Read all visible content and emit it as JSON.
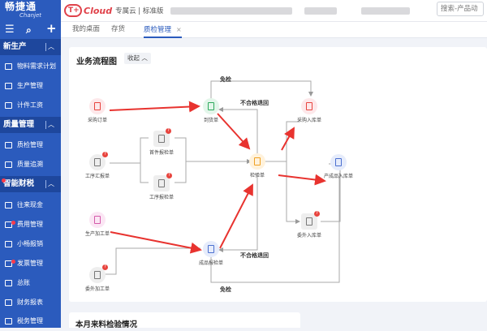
{
  "app": {
    "logo_cn": "畅捷通",
    "logo_en": "Chanjet"
  },
  "topbar": {
    "brand_name": "Cloud",
    "brand_sub": "专属云 | 标准版",
    "search_placeholder": "搜索-产品动"
  },
  "tabs": [
    {
      "label": "我的桌面"
    },
    {
      "label": "存货"
    },
    {
      "label": "质检管理",
      "close": "×"
    }
  ],
  "sidebar": {
    "groups": [
      {
        "label": "新生产",
        "items": [
          {
            "label": "物料需求计划"
          },
          {
            "label": "生产管理"
          },
          {
            "label": "计件工资"
          }
        ]
      },
      {
        "label": "质量管理",
        "items": [
          {
            "label": "质检管理"
          },
          {
            "label": "质量追溯"
          }
        ]
      },
      {
        "label": "智能财税",
        "items": [
          {
            "label": "往来现金"
          },
          {
            "label": "费用管理"
          },
          {
            "label": "小畅报销"
          },
          {
            "label": "发票管理"
          },
          {
            "label": "总账"
          },
          {
            "label": "财务报表"
          },
          {
            "label": "税务管理"
          }
        ]
      }
    ]
  },
  "flow_section": {
    "title": "业务流程图",
    "collapse_label": "收起",
    "nodes": {
      "purchase_order": "采购订单",
      "arrival_note": "到货单",
      "purchase_inbound": "采购入库单",
      "first_article": "首件报检单",
      "work_report": "工序汇报单",
      "process_inspection": "工序报检单",
      "inspection_order": "检验单",
      "product_inbound": "产成品入库单",
      "production_order": "生产加工单",
      "outsource_inbound": "委外入库单",
      "finished_inspection": "成品报检单",
      "outsource_order": "委外加工单"
    },
    "edge_labels": {
      "exempt_top": "免检",
      "reject_top": "不合格退回",
      "reject_bottom": "不合格退回",
      "exempt_bottom": "免检"
    }
  },
  "monthly_section": {
    "title": "本月来料检验情况"
  },
  "colors": {
    "sidebar": "#2b5bbd",
    "accent": "#2b5bbd",
    "arrow": "#e8332f"
  }
}
